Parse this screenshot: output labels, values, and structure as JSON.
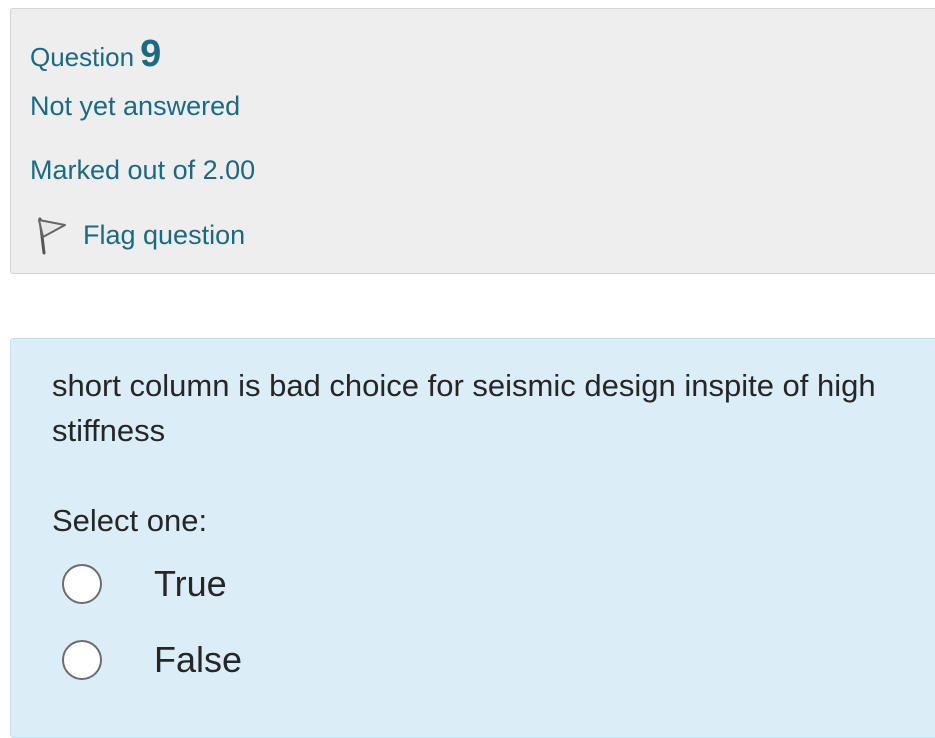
{
  "question_info": {
    "heading_label": "Question",
    "number": "9",
    "state": "Not yet answered",
    "grade": "Marked out of 2.00",
    "flag_label": "Flag question",
    "flag_icon": "flag-icon",
    "accent_color": "#1b6a84"
  },
  "question_content": {
    "text": "short column is bad choice for seismic design inspite of high stiffness",
    "prompt": "Select one:",
    "options": [
      {
        "label": "True",
        "selected": false
      },
      {
        "label": "False",
        "selected": false
      }
    ],
    "background_color": "#dbeef8"
  }
}
